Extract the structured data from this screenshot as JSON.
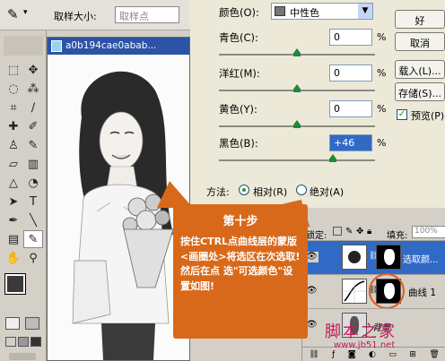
{
  "options_bar": {
    "sample_size_label": "取样大小:",
    "sample_size_value": "取样点"
  },
  "document": {
    "title": "a0b194cae0abab..."
  },
  "dialog": {
    "colors_label": "颜色(O):",
    "colors_value": "中性色",
    "sliders": [
      {
        "label": "青色(C):",
        "value": "0",
        "unit": "%"
      },
      {
        "label": "洋红(M):",
        "value": "0",
        "unit": "%"
      },
      {
        "label": "黄色(Y):",
        "value": "0",
        "unit": "%"
      },
      {
        "label": "黑色(B):",
        "value": "+46",
        "unit": "%"
      }
    ],
    "method_label": "方法:",
    "method_options": [
      "相对(R)",
      "绝对(A)"
    ],
    "method_selected": "相对(R)",
    "buttons": {
      "ok": "好",
      "cancel": "取消",
      "load": "载入(L)...",
      "save": "存储(S)..."
    },
    "preview_label": "预览(P)",
    "preview_checked": true
  },
  "layers": {
    "lock_label": "锁定:",
    "fill_label": "填充:",
    "fill_value": "100%",
    "items": [
      {
        "name": "选取颜..."
      },
      {
        "name": "曲线 1"
      },
      {
        "name": "背景"
      }
    ]
  },
  "callout": {
    "heading": "第十步",
    "text": "按住CTRL点曲线层的蒙版<画圈处>将选区在次选取!然后在点  选\"可选颜色\"设置如图!"
  },
  "watermark": {
    "site_name": "脚本之家",
    "url": "www.jb51.net"
  },
  "colors": {
    "foreground": "#3a3a3a",
    "background": "#d9691a",
    "accent": "#2c53a6"
  }
}
